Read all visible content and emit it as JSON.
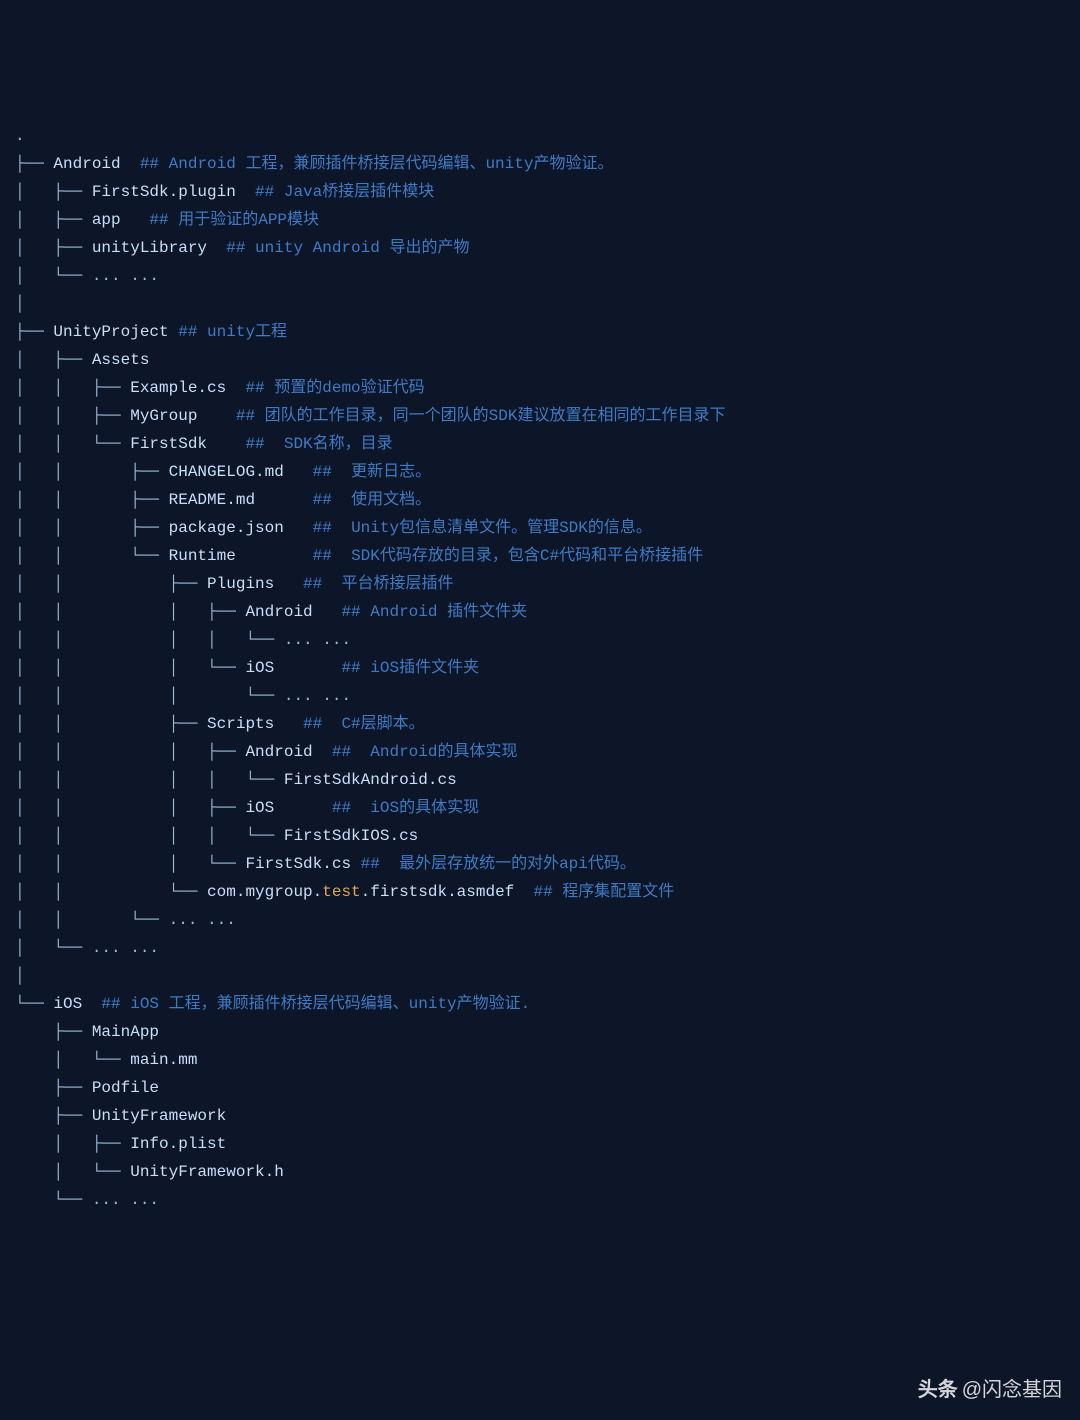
{
  "lines": [
    {
      "parts": [
        {
          "cls": "dot",
          "text": "."
        }
      ]
    },
    {
      "parts": [
        {
          "cls": "tree",
          "text": "├── "
        },
        {
          "cls": "name",
          "text": "Android  "
        },
        {
          "cls": "comment",
          "text": "## Android 工程，兼顾插件桥接层代码编辑、unity产物验证。"
        }
      ]
    },
    {
      "parts": [
        {
          "cls": "tree",
          "text": "│   ├── "
        },
        {
          "cls": "name",
          "text": "FirstSdk.plugin  "
        },
        {
          "cls": "comment",
          "text": "## Java桥接层插件模块"
        }
      ]
    },
    {
      "parts": [
        {
          "cls": "tree",
          "text": "│   ├── "
        },
        {
          "cls": "name",
          "text": "app   "
        },
        {
          "cls": "comment",
          "text": "## 用于验证的APP模块"
        }
      ]
    },
    {
      "parts": [
        {
          "cls": "tree",
          "text": "│   ├── "
        },
        {
          "cls": "name",
          "text": "unityLibrary  "
        },
        {
          "cls": "comment",
          "text": "## unity Android 导出的产物"
        }
      ]
    },
    {
      "parts": [
        {
          "cls": "tree",
          "text": "│   └── ... ..."
        }
      ]
    },
    {
      "parts": [
        {
          "cls": "tree",
          "text": "│"
        }
      ]
    },
    {
      "parts": [
        {
          "cls": "tree",
          "text": "├── "
        },
        {
          "cls": "name",
          "text": "UnityProject "
        },
        {
          "cls": "comment",
          "text": "## unity工程"
        }
      ]
    },
    {
      "parts": [
        {
          "cls": "tree",
          "text": "│   ├── "
        },
        {
          "cls": "name",
          "text": "Assets"
        }
      ]
    },
    {
      "parts": [
        {
          "cls": "tree",
          "text": "│   │   ├── "
        },
        {
          "cls": "name",
          "text": "Example.cs  "
        },
        {
          "cls": "comment",
          "text": "## 预置的demo验证代码"
        }
      ]
    },
    {
      "parts": [
        {
          "cls": "tree",
          "text": "│   │   ├── "
        },
        {
          "cls": "name",
          "text": "MyGroup    "
        },
        {
          "cls": "comment",
          "text": "## 团队的工作目录，同一个团队的SDK建议放置在相同的工作目录下"
        }
      ]
    },
    {
      "parts": [
        {
          "cls": "tree",
          "text": "│   │   └── "
        },
        {
          "cls": "name",
          "text": "FirstSdk    "
        },
        {
          "cls": "comment",
          "text": "##  SDK名称，目录"
        }
      ]
    },
    {
      "parts": [
        {
          "cls": "tree",
          "text": "│   │       ├── "
        },
        {
          "cls": "name",
          "text": "CHANGELOG.md   "
        },
        {
          "cls": "comment",
          "text": "##  更新日志。"
        }
      ]
    },
    {
      "parts": [
        {
          "cls": "tree",
          "text": "│   │       ├── "
        },
        {
          "cls": "name",
          "text": "README.md      "
        },
        {
          "cls": "comment",
          "text": "##  使用文档。"
        }
      ]
    },
    {
      "parts": [
        {
          "cls": "tree",
          "text": "│   │       ├── "
        },
        {
          "cls": "name",
          "text": "package.json   "
        },
        {
          "cls": "comment",
          "text": "##  Unity包信息清单文件。管理SDK的信息。"
        }
      ]
    },
    {
      "parts": [
        {
          "cls": "tree",
          "text": "│   │       └── "
        },
        {
          "cls": "name",
          "text": "Runtime        "
        },
        {
          "cls": "comment",
          "text": "##  SDK代码存放的目录，包含C#代码和平台桥接插件"
        }
      ]
    },
    {
      "parts": [
        {
          "cls": "tree",
          "text": "│   │           ├── "
        },
        {
          "cls": "name",
          "text": "Plugins   "
        },
        {
          "cls": "comment",
          "text": "##  平台桥接层插件"
        }
      ]
    },
    {
      "parts": [
        {
          "cls": "tree",
          "text": "│   │           │   ├── "
        },
        {
          "cls": "name",
          "text": "Android   "
        },
        {
          "cls": "comment",
          "text": "## Android 插件文件夹"
        }
      ]
    },
    {
      "parts": [
        {
          "cls": "tree",
          "text": "│   │           │   │   └── ... ..."
        }
      ]
    },
    {
      "parts": [
        {
          "cls": "tree",
          "text": "│   │           │   └── "
        },
        {
          "cls": "name",
          "text": "iOS       "
        },
        {
          "cls": "comment",
          "text": "## iOS插件文件夹"
        }
      ]
    },
    {
      "parts": [
        {
          "cls": "tree",
          "text": "│   │           │       └── ... ..."
        }
      ]
    },
    {
      "parts": [
        {
          "cls": "tree",
          "text": "│   │           ├── "
        },
        {
          "cls": "name",
          "text": "Scripts   "
        },
        {
          "cls": "comment",
          "text": "##  C#层脚本。"
        }
      ]
    },
    {
      "parts": [
        {
          "cls": "tree",
          "text": "│   │           │   ├── "
        },
        {
          "cls": "name",
          "text": "Android  "
        },
        {
          "cls": "comment",
          "text": "##  Android的具体实现"
        }
      ]
    },
    {
      "parts": [
        {
          "cls": "tree",
          "text": "│   │           │   │   └── "
        },
        {
          "cls": "name",
          "text": "FirstSdkAndroid.cs"
        }
      ]
    },
    {
      "parts": [
        {
          "cls": "tree",
          "text": "│   │           │   ├── "
        },
        {
          "cls": "name",
          "text": "iOS      "
        },
        {
          "cls": "comment",
          "text": "##  iOS的具体实现"
        }
      ]
    },
    {
      "parts": [
        {
          "cls": "tree",
          "text": "│   │           │   │   └── "
        },
        {
          "cls": "name",
          "text": "FirstSdkIOS.cs"
        }
      ]
    },
    {
      "parts": [
        {
          "cls": "tree",
          "text": "│   │           │   └── "
        },
        {
          "cls": "name",
          "text": "FirstSdk.cs "
        },
        {
          "cls": "comment",
          "text": "##  最外层存放统一的对外api代码。"
        }
      ]
    },
    {
      "parts": [
        {
          "cls": "tree",
          "text": "│   │           └── "
        },
        {
          "cls": "name",
          "text": "com.mygroup."
        },
        {
          "cls": "hl",
          "text": "test"
        },
        {
          "cls": "name",
          "text": ".firstsdk.asmdef  "
        },
        {
          "cls": "comment",
          "text": "## 程序集配置文件"
        }
      ]
    },
    {
      "parts": [
        {
          "cls": "tree",
          "text": "│   │       └── ... ..."
        }
      ]
    },
    {
      "parts": [
        {
          "cls": "tree",
          "text": "│   └── ... ..."
        }
      ]
    },
    {
      "parts": [
        {
          "cls": "tree",
          "text": "│"
        }
      ]
    },
    {
      "parts": [
        {
          "cls": "tree",
          "text": "└── "
        },
        {
          "cls": "name",
          "text": "iOS  "
        },
        {
          "cls": "comment",
          "text": "## iOS 工程，兼顾插件桥接层代码编辑、unity产物验证."
        }
      ]
    },
    {
      "parts": [
        {
          "cls": "tree",
          "text": "    ├── "
        },
        {
          "cls": "name",
          "text": "MainApp"
        }
      ]
    },
    {
      "parts": [
        {
          "cls": "tree",
          "text": "    │   └── "
        },
        {
          "cls": "name",
          "text": "main.mm"
        }
      ]
    },
    {
      "parts": [
        {
          "cls": "tree",
          "text": "    ├── "
        },
        {
          "cls": "name",
          "text": "Podfile"
        }
      ]
    },
    {
      "parts": [
        {
          "cls": "tree",
          "text": "    ├── "
        },
        {
          "cls": "name",
          "text": "UnityFramework"
        }
      ]
    },
    {
      "parts": [
        {
          "cls": "tree",
          "text": "    │   ├── "
        },
        {
          "cls": "name",
          "text": "Info.plist"
        }
      ]
    },
    {
      "parts": [
        {
          "cls": "tree",
          "text": "    │   └── "
        },
        {
          "cls": "name",
          "text": "UnityFramework.h"
        }
      ]
    },
    {
      "parts": [
        {
          "cls": "tree",
          "text": "    └── ... ..."
        }
      ]
    }
  ],
  "watermark": {
    "logo": "头条",
    "author": "@闪念基因"
  }
}
